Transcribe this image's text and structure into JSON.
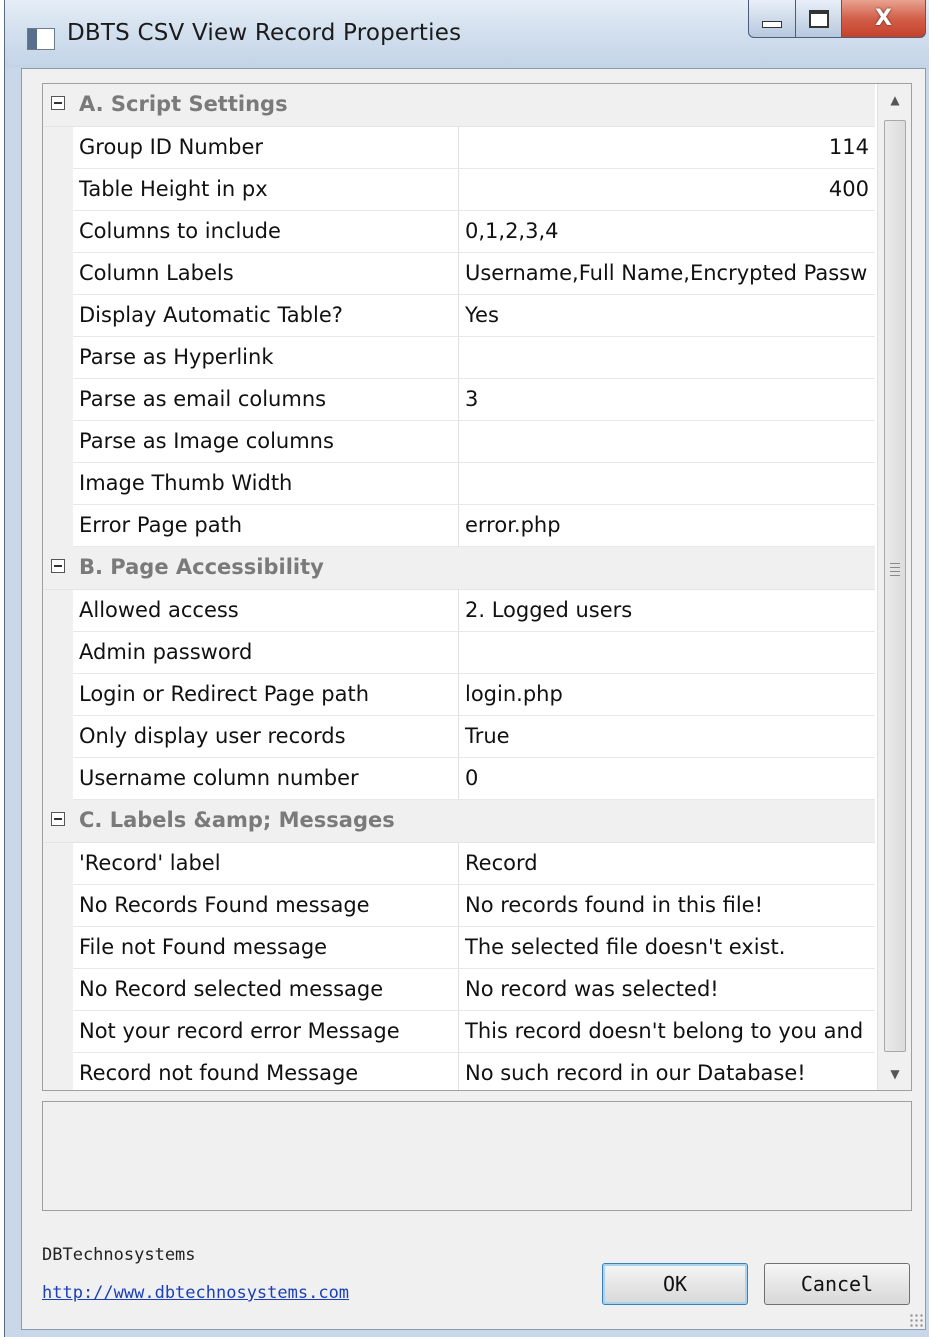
{
  "window": {
    "title": "DBTS CSV View Record Properties",
    "close_glyph": "X"
  },
  "grid": {
    "categories": [
      {
        "label": "A. Script Settings",
        "rows": [
          {
            "name": "Group ID Number",
            "value": "114",
            "numeric": true
          },
          {
            "name": "Table Height in px",
            "value": "400",
            "numeric": true
          },
          {
            "name": "Columns to include",
            "value": "0,1,2,3,4"
          },
          {
            "name": "Column Labels",
            "value": "Username,Full Name,Encrypted Passw"
          },
          {
            "name": "Display Automatic Table?",
            "value": "Yes"
          },
          {
            "name": "Parse as Hyperlink",
            "value": ""
          },
          {
            "name": "Parse as email columns",
            "value": "3"
          },
          {
            "name": "Parse as Image columns",
            "value": ""
          },
          {
            "name": "Image Thumb Width",
            "value": ""
          },
          {
            "name": "Error Page path",
            "value": "error.php"
          }
        ]
      },
      {
        "label": "B. Page Accessibility",
        "rows": [
          {
            "name": "Allowed access",
            "value": "2. Logged users"
          },
          {
            "name": "Admin password",
            "value": ""
          },
          {
            "name": "Login or Redirect Page path",
            "value": "login.php"
          },
          {
            "name": "Only display user records",
            "value": "True"
          },
          {
            "name": "Username column number",
            "value": "0"
          }
        ]
      },
      {
        "label": "C. Labels &amp; Messages",
        "rows": [
          {
            "name": "'Record' label",
            "value": "Record"
          },
          {
            "name": "No Records Found message",
            "value": "No records found in this file!"
          },
          {
            "name": "File not Found message",
            "value": "The selected file doesn't exist."
          },
          {
            "name": "No Record selected message",
            "value": "No record was selected!"
          },
          {
            "name": "Not your record error Message",
            "value": "This record doesn't belong to you and"
          },
          {
            "name": "Record not found Message",
            "value": "No such record in our Database!"
          }
        ]
      }
    ]
  },
  "footer": {
    "company": "DBTechnosystems",
    "link": "http://www.dbtechnosystems.com",
    "ok_label": "OK",
    "cancel_label": "Cancel"
  }
}
